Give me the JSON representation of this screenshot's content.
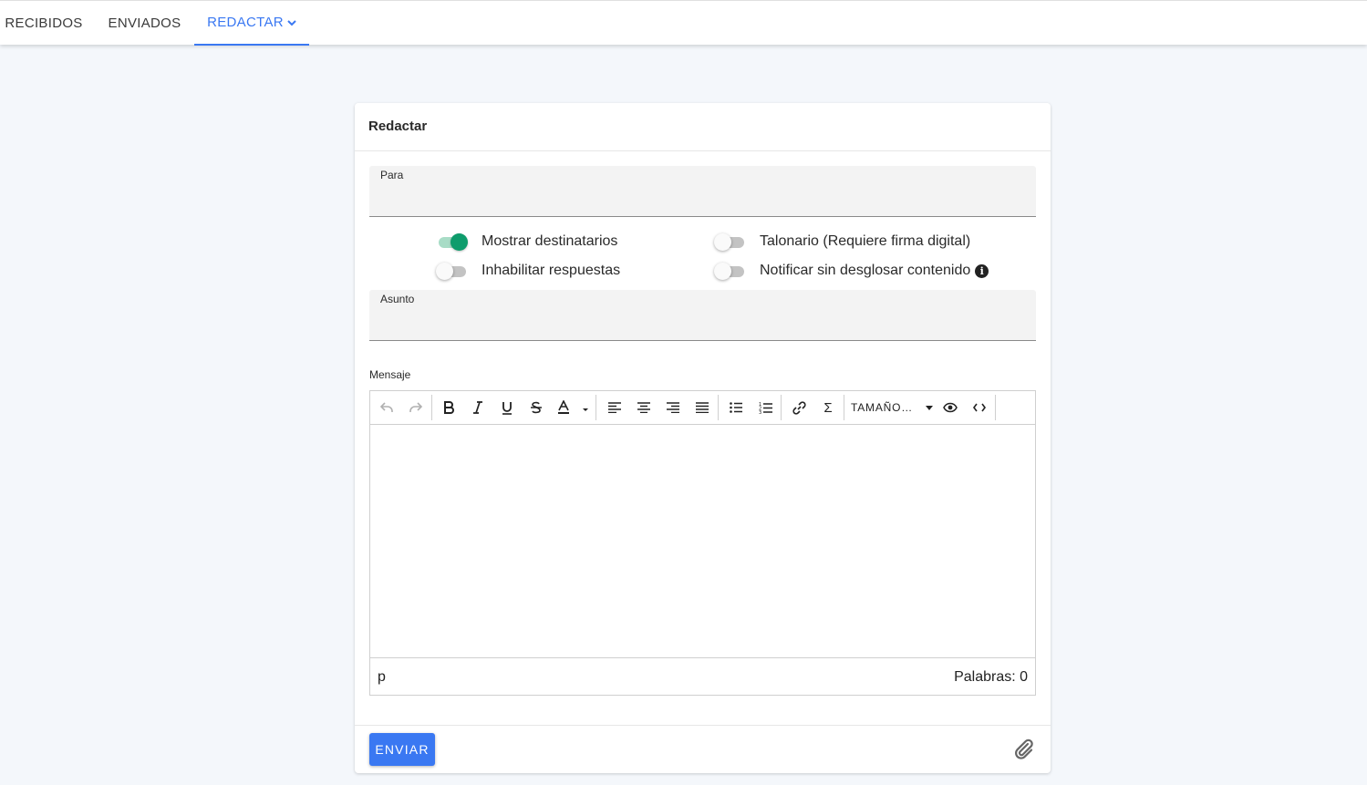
{
  "nav": {
    "tabs": [
      {
        "label": "RECIBIDOS"
      },
      {
        "label": "ENVIADOS"
      },
      {
        "label": "REDACTAR"
      }
    ],
    "active_color": "#3a78f2"
  },
  "card": {
    "title": "Redactar"
  },
  "fields": {
    "para_label": "Para",
    "para_value": "",
    "asunto_label": "Asunto",
    "asunto_value": ""
  },
  "switches": [
    {
      "label": "Mostrar destinatarios",
      "on": true
    },
    {
      "label": "Talonario (Requiere firma digital)",
      "on": false
    },
    {
      "label": "Inhabilitar respuestas",
      "on": false
    },
    {
      "label": "Notificar sin desglosar contenido",
      "on": false
    }
  ],
  "editor": {
    "label": "Mensaje",
    "toolbar": {
      "font_size_label": "TAMAÑO…",
      "sigma_glyph": "Σ",
      "icons": [
        "undo-icon",
        "redo-icon",
        "bold-icon",
        "italic-icon",
        "underline-icon",
        "strikethrough-icon",
        "font-color-icon",
        "align-left-icon",
        "align-center-icon",
        "align-right-icon",
        "align-justify-icon",
        "bullet-list-icon",
        "numbered-list-icon",
        "link-icon",
        "sigma-icon",
        "preview-icon",
        "code-icon"
      ]
    },
    "status_path": "p",
    "word_count": "Palabras: 0"
  },
  "footer": {
    "send_label": "ENVIAR",
    "send_color": "#3a78f2"
  },
  "colors": {
    "switch_on": "#0e9c6c",
    "background": "#f4f7fb"
  }
}
